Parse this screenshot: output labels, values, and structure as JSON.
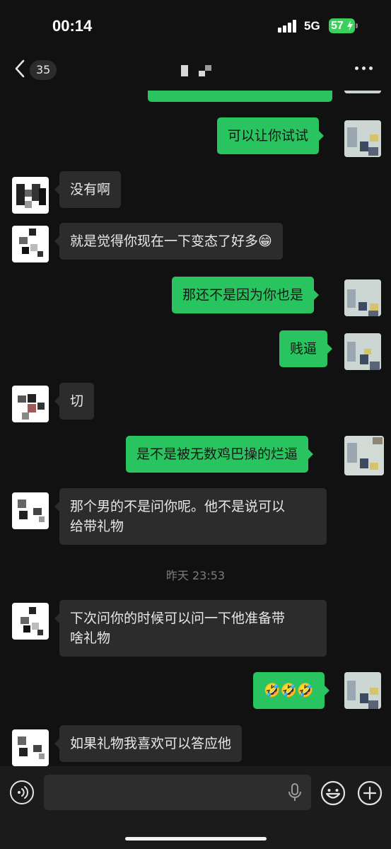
{
  "status": {
    "time": "00:14",
    "network": "5G",
    "battery": "57"
  },
  "nav": {
    "unread_count": "35"
  },
  "messages": [
    {
      "side": "right",
      "text": ""
    },
    {
      "side": "right",
      "text": "可以让你试试"
    },
    {
      "side": "left",
      "text": "没有啊"
    },
    {
      "side": "left",
      "text": "就是觉得你现在一下变态了好多😁"
    },
    {
      "side": "right",
      "text": "那还不是因为你也是"
    },
    {
      "side": "right",
      "text": "贱逼"
    },
    {
      "side": "left",
      "text": "切"
    },
    {
      "side": "right",
      "text": "是不是被无数鸡巴操的烂逼"
    },
    {
      "side": "left",
      "line1": "那个男的不是问你呢。他不是说可以",
      "line2": "给带礼物"
    },
    {
      "side": "left",
      "line1": "下次问你的时候可以问一下他准备带",
      "line2": "啥礼物"
    },
    {
      "side": "right",
      "text": "🤣🤣🤣"
    },
    {
      "side": "left",
      "text": "如果礼物我喜欢可以答应他"
    }
  ],
  "divider": {
    "timestamp": "昨天 23:53"
  },
  "input": {
    "value": ""
  },
  "colors": {
    "background": "#111111",
    "sent_bubble": "#29c45f",
    "received_bubble": "#2c2c2c",
    "battery": "#3ad15b"
  },
  "icons": [
    "back-chevron-icon",
    "more-icon",
    "voice-icon",
    "microphone-icon",
    "emoji-icon",
    "plus-icon",
    "signal-icon",
    "battery-icon"
  ]
}
